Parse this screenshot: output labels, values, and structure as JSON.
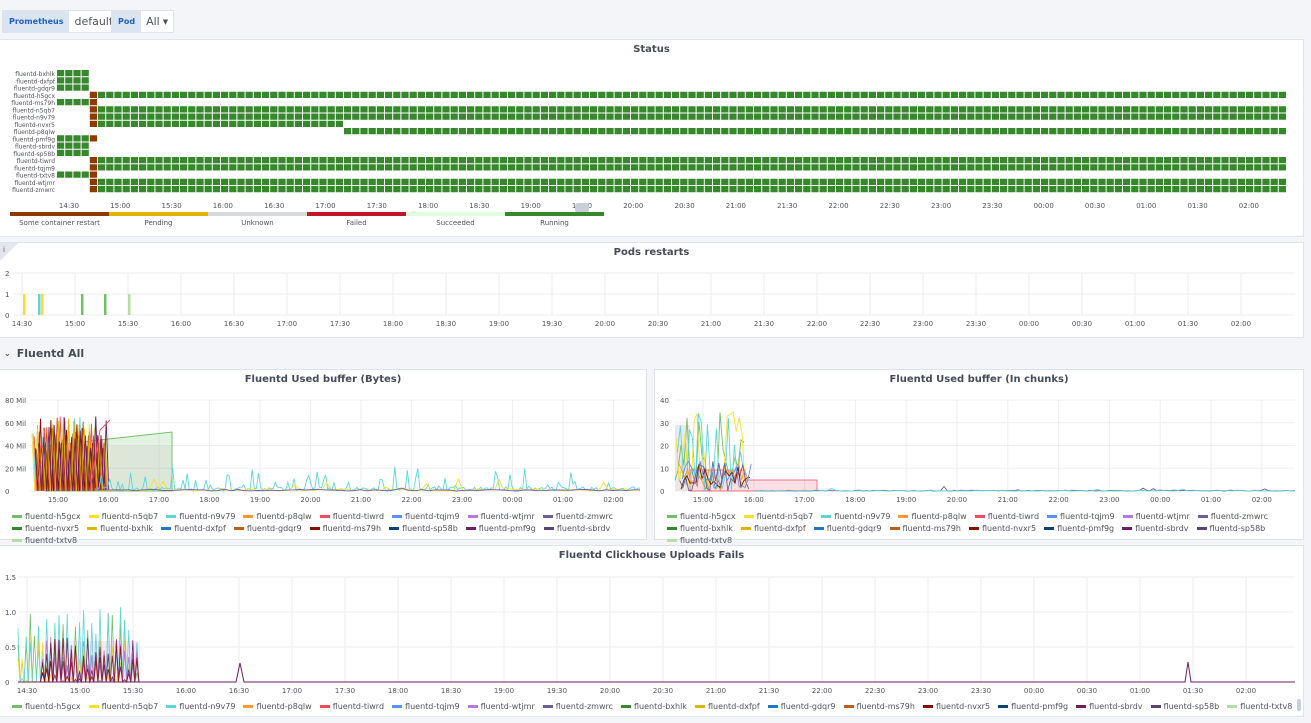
{
  "variables": [
    {
      "label": "Prometheus",
      "value": "default"
    },
    {
      "label": "Pod",
      "value": "All"
    }
  ],
  "time_ticks": [
    "14:30",
    "15:00",
    "15:30",
    "16:00",
    "16:30",
    "17:00",
    "17:30",
    "18:00",
    "18:30",
    "19:00",
    "19:30",
    "20:00",
    "20:30",
    "21:00",
    "21:30",
    "22:00",
    "22:30",
    "23:00",
    "23:30",
    "00:00",
    "00:30",
    "01:00",
    "01:30",
    "02:00"
  ],
  "status_panel": {
    "title": "Status",
    "pods": [
      "fluentd-bxhlk",
      "fluentd-dxfpf",
      "fluentd-gdqr9",
      "fluentd-h5gcx",
      "fluentd-ms79h",
      "fluentd-n5qb7",
      "fluentd-n9v79",
      "fluentd-nvxr5",
      "fluentd-p8qlw",
      "fluentd-pmf9g",
      "fluentd-sbrdv",
      "fluentd-sp58b",
      "fluentd-tiwrd",
      "fluentd-tqjm9",
      "fluentd-txtv8",
      "fluentd-wtjmr",
      "fluentd-zmwrc"
    ],
    "legend": [
      {
        "label": "Some container restart",
        "color": "#8f3b00"
      },
      {
        "label": "Pending",
        "color": "#e0b400"
      },
      {
        "label": "Unknown",
        "color": "#d8d9da"
      },
      {
        "label": "Failed",
        "color": "#c4162a"
      },
      {
        "label": "Succeeded",
        "color": "#dfffdf"
      },
      {
        "label": "Running",
        "color": "#37872d"
      }
    ]
  },
  "restarts_panel": {
    "title": "Pods restarts",
    "info": "i",
    "y_ticks": [
      "2",
      "1",
      "0"
    ]
  },
  "row": {
    "title": "Fluentd All"
  },
  "bytes_panel": {
    "title": "Fluentd Used buffer (Bytes)",
    "y_ticks": [
      "80 Mil",
      "60 Mil",
      "40 Mil",
      "20 Mil",
      "0"
    ],
    "x_ticks": [
      "15:00",
      "16:00",
      "17:00",
      "18:00",
      "19:00",
      "20:00",
      "21:00",
      "22:00",
      "23:00",
      "00:00",
      "01:00",
      "02:00"
    ]
  },
  "chunks_panel": {
    "title": "Fluentd Used buffer (In chunks)",
    "y_ticks": [
      "40",
      "30",
      "20",
      "10",
      "0"
    ],
    "x_ticks": [
      "15:00",
      "16:00",
      "17:00",
      "18:00",
      "19:00",
      "20:00",
      "21:00",
      "22:00",
      "23:00",
      "00:00",
      "01:00",
      "02:00"
    ]
  },
  "uploads_panel": {
    "title": "Fluentd Clickhouse Uploads Fails",
    "y_ticks": [
      "1.5",
      "1.0",
      "0.5",
      "0"
    ]
  },
  "legend_left": [
    {
      "label": "fluentd-h5gcx",
      "color": "#73bf69"
    },
    {
      "label": "fluentd-n5qb7",
      "color": "#fade2a"
    },
    {
      "label": "fluentd-n9v79",
      "color": "#5ed6d6"
    },
    {
      "label": "fluentd-p8qlw",
      "color": "#ff9830"
    },
    {
      "label": "fluentd-tiwrd",
      "color": "#f2495c"
    },
    {
      "label": "fluentd-tqjm9",
      "color": "#5794f2"
    },
    {
      "label": "fluentd-wtjmr",
      "color": "#b877d9"
    },
    {
      "label": "fluentd-zmwrc",
      "color": "#705da0"
    },
    {
      "label": "fluentd-nvxr5",
      "color": "#37872d"
    },
    {
      "label": "fluentd-bxhlk",
      "color": "#e0b400"
    },
    {
      "label": "fluentd-dxfpf",
      "color": "#1f78c1"
    },
    {
      "label": "fluentd-gdqr9",
      "color": "#c15c17"
    },
    {
      "label": "fluentd-ms79h",
      "color": "#890f02"
    },
    {
      "label": "fluentd-sp58b",
      "color": "#0a437c"
    },
    {
      "label": "fluentd-pmf9g",
      "color": "#6d1f62"
    },
    {
      "label": "fluentd-sbrdv",
      "color": "#584477"
    },
    {
      "label": "fluentd-txtv8",
      "color": "#b7dbab"
    }
  ],
  "legend_right": [
    {
      "label": "fluentd-h5gcx",
      "color": "#73bf69"
    },
    {
      "label": "fluentd-n5qb7",
      "color": "#fade2a"
    },
    {
      "label": "fluentd-n9v79",
      "color": "#5ed6d6"
    },
    {
      "label": "fluentd-p8qlw",
      "color": "#ff9830"
    },
    {
      "label": "fluentd-tiwrd",
      "color": "#f2495c"
    },
    {
      "label": "fluentd-tqjm9",
      "color": "#5794f2"
    },
    {
      "label": "fluentd-wtjmr",
      "color": "#b877d9"
    },
    {
      "label": "fluentd-zmwrc",
      "color": "#705da0"
    },
    {
      "label": "fluentd-bxhlk",
      "color": "#37872d"
    },
    {
      "label": "fluentd-dxfpf",
      "color": "#e0b400"
    },
    {
      "label": "fluentd-gdqr9",
      "color": "#1f78c1"
    },
    {
      "label": "fluentd-ms79h",
      "color": "#c15c17"
    },
    {
      "label": "fluentd-nvxr5",
      "color": "#890f02"
    },
    {
      "label": "fluentd-pmf9g",
      "color": "#0a437c"
    },
    {
      "label": "fluentd-sbrdv",
      "color": "#6d1f62"
    },
    {
      "label": "fluentd-sp58b",
      "color": "#584477"
    },
    {
      "label": "fluentd-txtv8",
      "color": "#b7dbab"
    }
  ],
  "legend_bottom": [
    {
      "label": "fluentd-h5gcx",
      "color": "#73bf69"
    },
    {
      "label": "fluentd-n5qb7",
      "color": "#fade2a"
    },
    {
      "label": "fluentd-n9v79",
      "color": "#5ed6d6"
    },
    {
      "label": "fluentd-p8qlw",
      "color": "#ff9830"
    },
    {
      "label": "fluentd-tiwrd",
      "color": "#f2495c"
    },
    {
      "label": "fluentd-tqjm9",
      "color": "#5794f2"
    },
    {
      "label": "fluentd-wtjmr",
      "color": "#b877d9"
    },
    {
      "label": "fluentd-zmwrc",
      "color": "#705da0"
    },
    {
      "label": "fluentd-bxhlk",
      "color": "#37872d"
    },
    {
      "label": "fluentd-dxfpf",
      "color": "#e0b400"
    },
    {
      "label": "fluentd-gdqr9",
      "color": "#1f78c1"
    },
    {
      "label": "fluentd-ms79h",
      "color": "#c15c17"
    },
    {
      "label": "fluentd-nvxr5",
      "color": "#890f02"
    },
    {
      "label": "fluentd-pmf9g",
      "color": "#0a437c"
    },
    {
      "label": "fluentd-sbrdv",
      "color": "#6d1f62"
    },
    {
      "label": "fluentd-sp58b",
      "color": "#584477"
    },
    {
      "label": "fluentd-txtv8",
      "color": "#b7dbab"
    }
  ]
}
